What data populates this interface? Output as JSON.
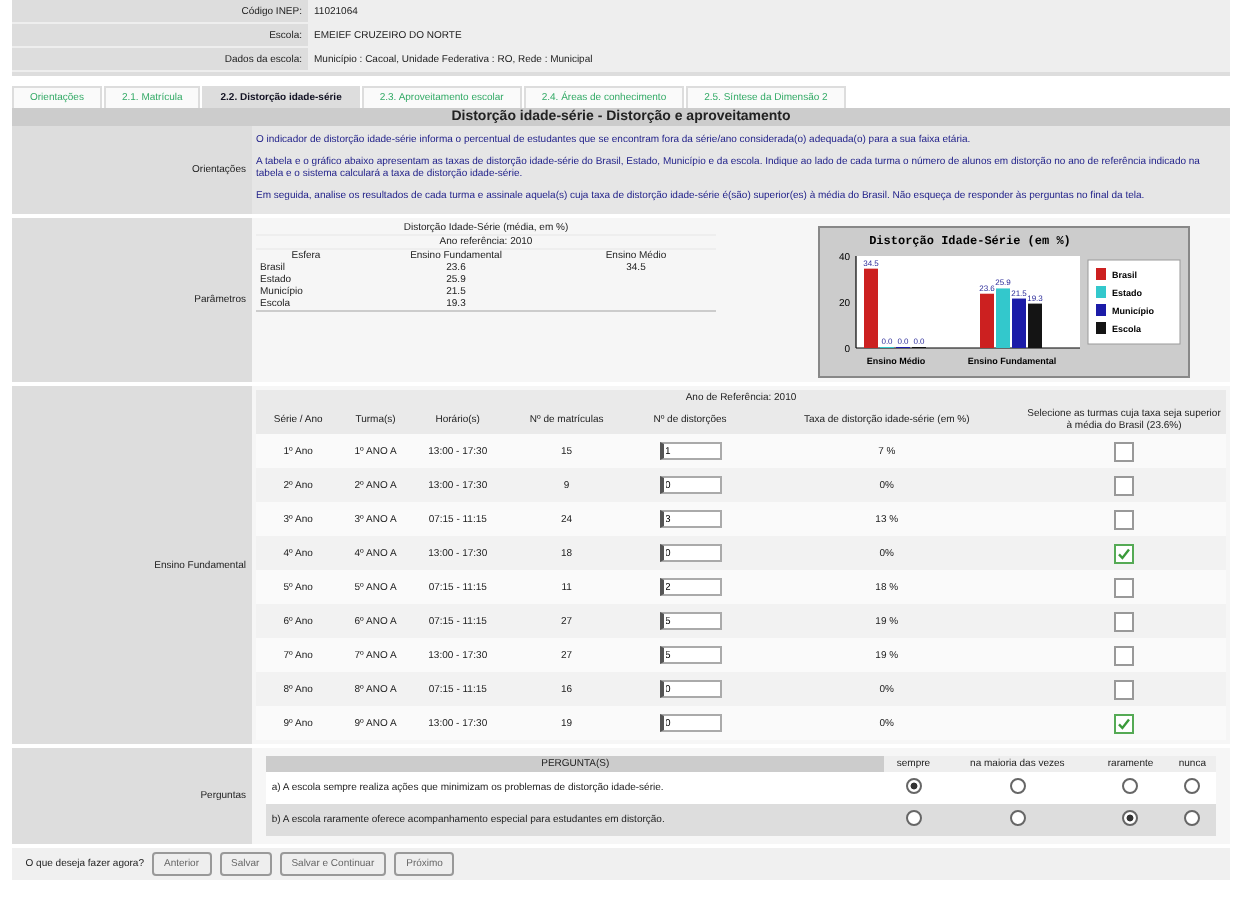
{
  "school_info": [
    {
      "label": "Código INEP:",
      "value": "11021064"
    },
    {
      "label": "Escola:",
      "value": "EMEIEF CRUZEIRO DO NORTE"
    },
    {
      "label": "Dados da escola:",
      "value": "Município : Cacoal, Unidade Federativa : RO, Rede : Municipal"
    }
  ],
  "tabs": [
    {
      "label": "Orientações",
      "selected": false
    },
    {
      "label": "2.1. Matrícula",
      "selected": false
    },
    {
      "label": "2.2. Distorção idade-série",
      "selected": true
    },
    {
      "label": "2.3. Aproveitamento escolar",
      "selected": false
    },
    {
      "label": "2.4. Áreas de conhecimento",
      "selected": false
    },
    {
      "label": "2.5. Síntese da Dimensão 2",
      "selected": false
    }
  ],
  "section_title": "Distorção idade-série - Distorção e aproveitamento",
  "orientacoes": {
    "label": "Orientações",
    "paragraphs": [
      "O indicador de distorção idade-série informa o percentual de estudantes que se encontram fora da série/ano considerada(o) adequada(o) para a sua faixa etária.",
      "A tabela e o gráfico abaixo apresentam as taxas de distorção idade-série do Brasil, Estado, Município e da escola. Indique ao lado de cada turma o número de alunos em distorção no ano de referência indicado na tabela e o sistema calculará a taxa de distorção idade-série.",
      "Em seguida, analise os resultados de cada turma e assinale aquela(s) cuja taxa de distorção idade-série é(são) superior(es) à média do Brasil. Não esqueça de responder às perguntas no final da tela."
    ]
  },
  "parametros": {
    "label": "Parâmetros",
    "table_title": "Distorção Idade-Série (média, em %)",
    "reference_year": "Ano referência: 2010",
    "columns": [
      "Esfera",
      "Ensino Fundamental",
      "Ensino Médio"
    ],
    "rows": [
      [
        "Brasil",
        "23.6",
        "34.5"
      ],
      [
        "Estado",
        "25.9",
        ""
      ],
      [
        "Município",
        "21.5",
        ""
      ],
      [
        "Escola",
        "19.3",
        ""
      ]
    ],
    "chart_data": {
      "type": "bar",
      "title": "Distorção Idade-Série (em %)",
      "categories": [
        "Ensino Médio",
        "Ensino Fundamental"
      ],
      "series": [
        {
          "name": "Brasil",
          "color": "#cc2020",
          "values": [
            34.5,
            23.6
          ],
          "value_labels": [
            "34.5",
            "23.6"
          ]
        },
        {
          "name": "Estado",
          "color": "#33c8cc",
          "values": [
            0,
            25.9
          ],
          "value_labels": [
            "0.0",
            "25.9"
          ]
        },
        {
          "name": "Município",
          "color": "#1c1ca8",
          "values": [
            0,
            21.5
          ],
          "value_labels": [
            "0.0",
            "21.5"
          ]
        },
        {
          "name": "Escola",
          "color": "#141414",
          "values": [
            0,
            19.3
          ],
          "value_labels": [
            "0.0",
            "19.3"
          ]
        }
      ],
      "ylim": [
        0,
        40
      ],
      "yticks": [
        0,
        20,
        40
      ],
      "data_labels": true,
      "legend": "right"
    }
  },
  "ensino": {
    "label": "Ensino Fundamental",
    "reference_year": "Ano de Referência: 2010",
    "columns": [
      "Série / Ano",
      "Turma(s)",
      "Horário(s)",
      "Nº de matrículas",
      "Nº de distorções",
      "Taxa de distorção idade-série (em %)",
      "Selecione as turmas cuja taxa seja superior à média do Brasil (23.6%)"
    ],
    "rows": [
      {
        "serie": "1º Ano",
        "turma": "1º ANO A",
        "horario": "13:00 - 17:30",
        "matriculas": "15",
        "distorcoes": "1",
        "taxa": "7 %",
        "checked": false
      },
      {
        "serie": "2º Ano",
        "turma": "2º ANO A",
        "horario": "13:00 - 17:30",
        "matriculas": "9",
        "distorcoes": "0",
        "taxa": "0%",
        "checked": false
      },
      {
        "serie": "3º Ano",
        "turma": "3º ANO A",
        "horario": "07:15 - 11:15",
        "matriculas": "24",
        "distorcoes": "3",
        "taxa": "13 %",
        "checked": false
      },
      {
        "serie": "4º Ano",
        "turma": "4º ANO A",
        "horario": "13:00 - 17:30",
        "matriculas": "18",
        "distorcoes": "0",
        "taxa": "0%",
        "checked": true
      },
      {
        "serie": "5º Ano",
        "turma": "5º ANO A",
        "horario": "07:15 - 11:15",
        "matriculas": "11",
        "distorcoes": "2",
        "taxa": "18 %",
        "checked": false
      },
      {
        "serie": "6º Ano",
        "turma": "6º ANO A",
        "horario": "07:15 - 11:15",
        "matriculas": "27",
        "distorcoes": "5",
        "taxa": "19 %",
        "checked": false
      },
      {
        "serie": "7º Ano",
        "turma": "7º ANO A",
        "horario": "13:00 - 17:30",
        "matriculas": "27",
        "distorcoes": "5",
        "taxa": "19 %",
        "checked": false
      },
      {
        "serie": "8º Ano",
        "turma": "8º ANO A",
        "horario": "07:15 - 11:15",
        "matriculas": "16",
        "distorcoes": "0",
        "taxa": "0%",
        "checked": false
      },
      {
        "serie": "9º Ano",
        "turma": "9º ANO A",
        "horario": "13:00 - 17:30",
        "matriculas": "19",
        "distorcoes": "0",
        "taxa": "0%",
        "checked": true
      }
    ]
  },
  "perguntas": {
    "label": "Perguntas",
    "header": "PERGUNTA(S)",
    "options": [
      "sempre",
      "na maioria das vezes",
      "raramente",
      "nunca"
    ],
    "questions": [
      {
        "text": "a) A escola sempre realiza ações que minimizam os problemas de distorção idade-série.",
        "choices": [
          {
            "selected": true
          },
          {
            "selected": false
          },
          {
            "selected": false
          },
          {
            "selected": false
          }
        ]
      },
      {
        "text": "b) A escola raramente oferece acompanhamento especial para estudantes em distorção.",
        "choices": [
          {
            "selected": false
          },
          {
            "selected": false
          },
          {
            "selected": true
          },
          {
            "selected": false
          }
        ]
      }
    ]
  },
  "actions": {
    "label": "O que deseja fazer agora?",
    "buttons": [
      "Anterior",
      "Salvar",
      "Salvar e Continuar",
      "Próximo"
    ]
  }
}
